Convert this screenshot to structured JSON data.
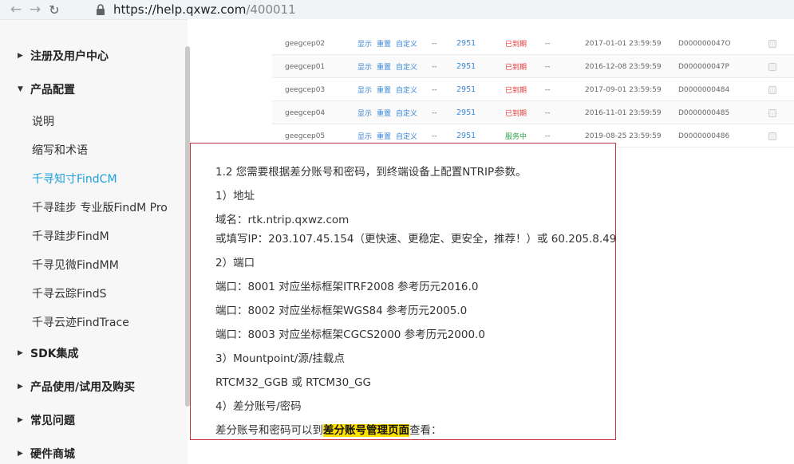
{
  "browser": {
    "url_host": "https://help.qxwz.com",
    "url_path": "/400011"
  },
  "sidebar": {
    "items": [
      {
        "label": "注册及用户中心",
        "type": "group",
        "expanded": false
      },
      {
        "label": "产品配置",
        "type": "group",
        "expanded": true
      },
      {
        "label": "说明",
        "type": "sub"
      },
      {
        "label": "缩写和术语",
        "type": "sub"
      },
      {
        "label": "千寻知寸FindCM",
        "type": "sub",
        "active": true
      },
      {
        "label": "千寻跬步 专业版FindM Pro",
        "type": "sub"
      },
      {
        "label": "千寻跬步FindM",
        "type": "sub"
      },
      {
        "label": "千寻见微FindMM",
        "type": "sub"
      },
      {
        "label": "千寻云踪FindS",
        "type": "sub"
      },
      {
        "label": "千寻云迹FindTrace",
        "type": "sub"
      },
      {
        "label": "SDK集成",
        "type": "group",
        "expanded": false
      },
      {
        "label": "产品使用/试用及购买",
        "type": "group",
        "expanded": false
      },
      {
        "label": "常见问题",
        "type": "group",
        "expanded": false
      },
      {
        "label": "硬件商城",
        "type": "group",
        "expanded": false
      }
    ]
  },
  "table": {
    "rows": [
      {
        "name": "geegcep02",
        "links": [
          "显示",
          "重置",
          "自定义"
        ],
        "dash1": "--",
        "num": "2951",
        "status": "已到期",
        "status_type": "expired",
        "dash2": "--",
        "date": "2017-01-01 23:59:59",
        "code": "D000000047O"
      },
      {
        "name": "geegcep01",
        "links": [
          "显示",
          "重置",
          "自定义"
        ],
        "dash1": "--",
        "num": "2951",
        "status": "已到期",
        "status_type": "expired",
        "dash2": "--",
        "date": "2016-12-08 23:59:59",
        "code": "D000000047P"
      },
      {
        "name": "geegcep03",
        "links": [
          "显示",
          "重置",
          "自定义"
        ],
        "dash1": "--",
        "num": "2951",
        "status": "已到期",
        "status_type": "expired",
        "dash2": "--",
        "date": "2017-09-01 23:59:59",
        "code": "D0000000484"
      },
      {
        "name": "geegcep04",
        "links": [
          "显示",
          "重置",
          "自定义"
        ],
        "dash1": "--",
        "num": "2951",
        "status": "已到期",
        "status_type": "expired",
        "dash2": "--",
        "date": "2016-11-01 23:59:59",
        "code": "D0000000485"
      },
      {
        "name": "geegcep05",
        "links": [
          "显示",
          "重置",
          "自定义"
        ],
        "dash1": "--",
        "num": "2951",
        "status": "服务中",
        "status_type": "active",
        "dash2": "--",
        "date": "2019-08-25 23:59:59",
        "code": "D0000000486"
      }
    ]
  },
  "content": {
    "heading": "1.2  您需要根据差分账号和密码，到终端设备上配置NTRIP参数。",
    "s1_title": "1）地址",
    "domain_line": "域名：rtk.ntrip.qxwz.com",
    "ip_line": "或填写IP：203.107.45.154（更快速、更稳定、更安全，推荐！）或 60.205.8.49",
    "s2_title": "2）端口",
    "port1": "端口：8001   对应坐标框架ITRF2008      参考历元2016.0",
    "port2": "端口：8002   对应坐标框架WGS84         参考历元2005.0",
    "port3": "端口：8003   对应坐标框架CGCS2000    参考历元2000.0",
    "s3_title": "3）Mountpoint/源/挂载点",
    "mount_line": "RTCM32_GGB 或 RTCM30_GG",
    "s4_title": "4）差分账号/密码",
    "final_pre": "差分账号和密码可以到",
    "final_link": "差分账号管理页面",
    "final_post": "查看："
  },
  "colors": {
    "accent": "#1e9fd9",
    "box_border": "#c8323c",
    "highlight": "#ffe100",
    "expired": "#e23b3b",
    "active": "#2fa24a"
  }
}
